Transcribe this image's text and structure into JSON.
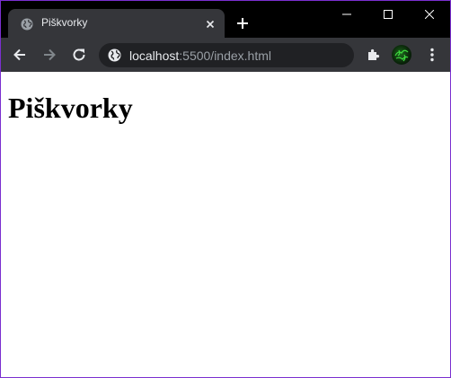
{
  "browser": {
    "tab": {
      "title": "Piškvorky"
    },
    "address_bar": {
      "url_host": "localhost",
      "url_rest": ":5500/index.html"
    },
    "icons": {
      "favicon": "globe-icon",
      "tab_close": "close-icon",
      "new_tab": "plus-icon",
      "minimize": "minimize-icon",
      "maximize": "maximize-icon",
      "window_close": "close-icon",
      "back": "arrow-left-icon",
      "forward": "arrow-right-icon",
      "reload": "reload-icon",
      "site_info": "globe-icon",
      "extensions": "puzzle-icon",
      "profile": "avatar",
      "menu": "kebab-menu-icon"
    },
    "colors": {
      "frame": "#000000",
      "toolbar": "#35363a",
      "omnibox": "#202124",
      "window_border": "#7b2fd0"
    }
  },
  "page": {
    "heading": "Piškvorky"
  }
}
